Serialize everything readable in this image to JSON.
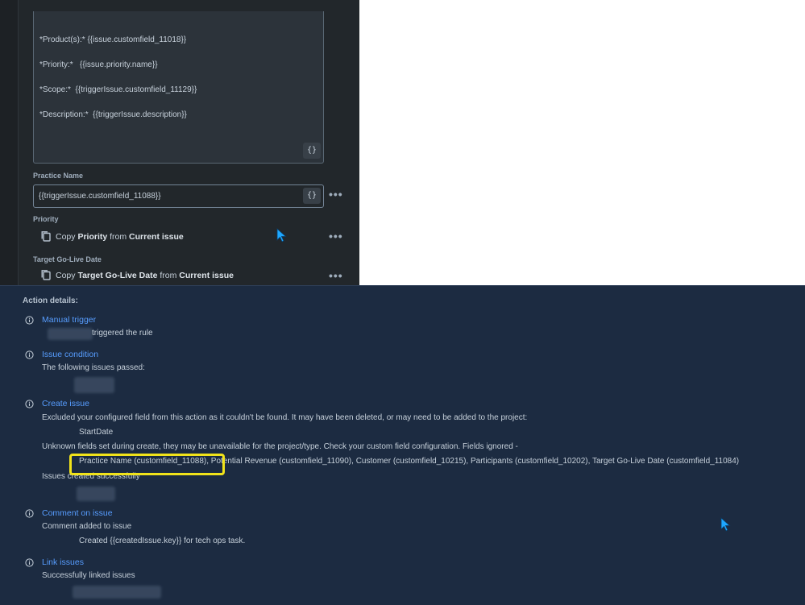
{
  "editor": {
    "template_lines": [
      "*Product(s):* {{issue.customfield_11018}}",
      "*Priority:*   {{issue.priority.name}}",
      "*Scope:*  {{triggerIssue.customfield_11129}}",
      "*Description:*  {{triggerIssue.description}}"
    ],
    "smart_value_button": "{}",
    "practice_name": {
      "label": "Practice Name",
      "value": "{{triggerIssue.customfield_11088}}"
    },
    "priority": {
      "label": "Priority",
      "copy_prefix": "Copy ",
      "field": "Priority",
      "from_word": " from ",
      "source": "Current issue"
    },
    "target_go_live": {
      "label": "Target Go-Live Date",
      "copy_prefix": "Copy ",
      "field": "Target Go-Live Date",
      "from_word": " from ",
      "source": "Current issue"
    },
    "more_label": "•••"
  },
  "log": {
    "title": "Action details:",
    "manual_trigger": {
      "title": "Manual trigger",
      "text": "triggered the rule"
    },
    "issue_condition": {
      "title": "Issue condition",
      "text": "The following issues passed:"
    },
    "create_issue": {
      "title": "Create issue",
      "excluded_text": "Excluded your configured field from this action as it couldn't be found. It may have been deleted, or may need to be added to the project:",
      "excluded_field": "StartDate",
      "unknown_text": "Unknown fields set during create, they may be unavailable for the project/type. Check your custom field configuration. Fields ignored -",
      "ignored_fields": "Practice Name (customfield_11088), Potential Revenue (customfield_11090), Customer (customfield_10215), Participants (customfield_10202), Target Go-Live Date (customfield_11084)",
      "created_text": "Issues created successfully"
    },
    "comment_on_issue": {
      "title": "Comment on issue",
      "text": "Comment added to issue",
      "comment": "Created {{createdIssue.key}} for tech ops task."
    },
    "link_issues": {
      "title": "Link issues",
      "text": "Successfully linked issues"
    }
  },
  "colors": {
    "link": "#579dff",
    "highlight": "#f1e31a",
    "cursor": "#1ea7ff"
  }
}
